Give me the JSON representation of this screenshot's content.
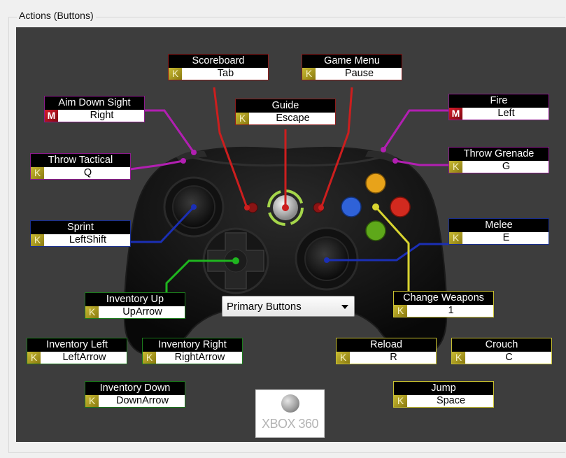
{
  "group_title": "Actions (Buttons)",
  "dropdown": {
    "selected": "Primary Buttons"
  },
  "logo_text": "XBOX 360",
  "bindings": {
    "scoreboard": {
      "title": "Scoreboard",
      "key_type": "K",
      "value": "Tab"
    },
    "game_menu": {
      "title": "Game Menu",
      "key_type": "K",
      "value": "Pause"
    },
    "guide": {
      "title": "Guide",
      "key_type": "K",
      "value": "Escape"
    },
    "aim_down_sight": {
      "title": "Aim Down Sight",
      "key_type": "M",
      "value": "Right"
    },
    "fire": {
      "title": "Fire",
      "key_type": "M",
      "value": "Left"
    },
    "throw_tactical": {
      "title": "Throw Tactical",
      "key_type": "K",
      "value": "Q"
    },
    "throw_grenade": {
      "title": "Throw Grenade",
      "key_type": "K",
      "value": "G"
    },
    "sprint": {
      "title": "Sprint",
      "key_type": "K",
      "value": "LeftShift"
    },
    "melee": {
      "title": "Melee",
      "key_type": "K",
      "value": "E"
    },
    "inventory_up": {
      "title": "Inventory Up",
      "key_type": "K",
      "value": "UpArrow"
    },
    "change_weapons": {
      "title": "Change Weapons",
      "key_type": "K",
      "value": "1"
    },
    "inventory_left": {
      "title": "Inventory Left",
      "key_type": "K",
      "value": "LeftArrow"
    },
    "inventory_right": {
      "title": "Inventory Right",
      "key_type": "K",
      "value": "RightArrow"
    },
    "reload": {
      "title": "Reload",
      "key_type": "K",
      "value": "R"
    },
    "crouch": {
      "title": "Crouch",
      "key_type": "K",
      "value": "C"
    },
    "inventory_down": {
      "title": "Inventory Down",
      "key_type": "K",
      "value": "DownArrow"
    },
    "jump": {
      "title": "Jump",
      "key_type": "K",
      "value": "Space"
    }
  },
  "colors": {
    "panel_bg": "#3d3d3d",
    "system_buttons": "#cc1e1e",
    "triggers_bumpers": "#b21fb2",
    "sticks": "#1b2fb5",
    "dpad": "#1fb51f",
    "face_buttons": "#d9d530"
  }
}
